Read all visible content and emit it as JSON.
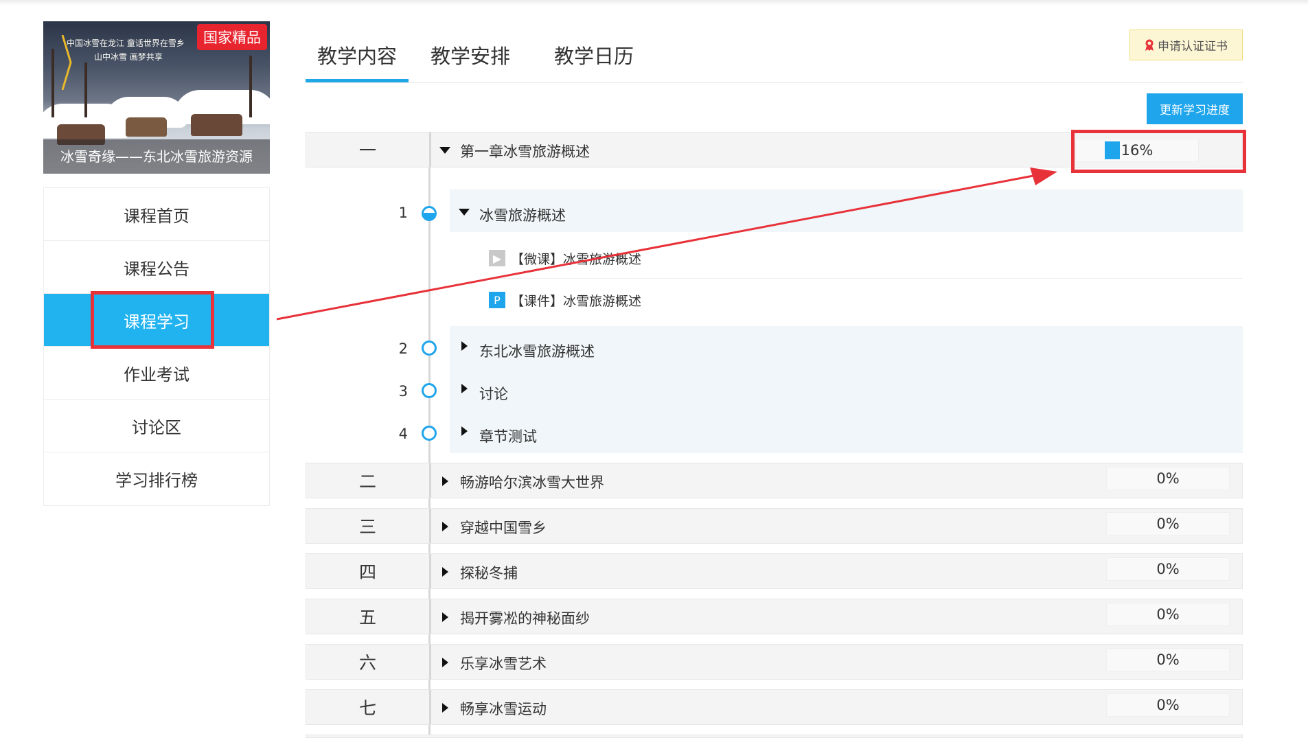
{
  "course": {
    "badge": "国家精品",
    "slogan_line1": "中国冰雪在龙江 童话世界在雪乡",
    "slogan_line2": "山中冰雪 画梦共享",
    "caption": "冰雪奇缘——东北冰雪旅游资源"
  },
  "sidebar": {
    "items": [
      {
        "label": "课程首页"
      },
      {
        "label": "课程公告"
      },
      {
        "label": "课程学习"
      },
      {
        "label": "作业考试"
      },
      {
        "label": "讨论区"
      },
      {
        "label": "学习排行榜"
      }
    ],
    "active_index": 2
  },
  "tabs": [
    {
      "label": "教学内容"
    },
    {
      "label": "教学安排"
    },
    {
      "label": "教学日历"
    }
  ],
  "buttons": {
    "certificate": "申请认证证书",
    "update_progress": "更新学习进度"
  },
  "chapters": [
    {
      "num": "一",
      "title": "第一章冰雪旅游概述",
      "progress_text": "16%",
      "progress": 0.16,
      "expanded": true
    },
    {
      "num": "二",
      "title": "畅游哈尔滨冰雪大世界",
      "progress_text": "0%",
      "progress": 0
    },
    {
      "num": "三",
      "title": "穿越中国雪乡",
      "progress_text": "0%",
      "progress": 0
    },
    {
      "num": "四",
      "title": "探秘冬捕",
      "progress_text": "0%",
      "progress": 0
    },
    {
      "num": "五",
      "title": "揭开雾凇的神秘面纱",
      "progress_text": "0%",
      "progress": 0
    },
    {
      "num": "六",
      "title": "乐享冰雪艺术",
      "progress_text": "0%",
      "progress": 0
    },
    {
      "num": "七",
      "title": "畅享冰雪运动",
      "progress_text": "0%",
      "progress": 0
    }
  ],
  "sections": [
    {
      "num": "1",
      "title": "冰雪旅游概述",
      "expanded": true
    },
    {
      "num": "2",
      "title": "东北冰雪旅游概述"
    },
    {
      "num": "3",
      "title": "讨论"
    },
    {
      "num": "4",
      "title": "章节测试"
    }
  ],
  "lessons": [
    {
      "icon": "play-icon",
      "glyph": "▶",
      "title": "【微课】冰雪旅游概述"
    },
    {
      "icon": "ppt-icon",
      "glyph": "P",
      "title": "【课件】冰雪旅游概述"
    }
  ],
  "colors": {
    "accent": "#1fa5ec",
    "sidebar_active": "#20b3f0",
    "highlight": "#e8323a"
  }
}
